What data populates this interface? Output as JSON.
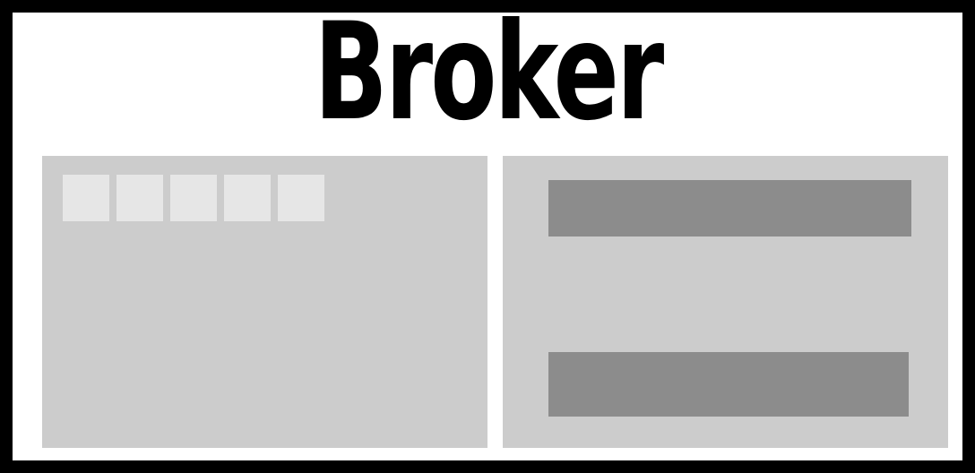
{
  "title": "Broker",
  "colors": {
    "border": "#000000",
    "background": "#ffffff",
    "panel": "#cccccc",
    "tile": "#e6e6e6",
    "bar": "#8c8c8c",
    "title_text": "#000000"
  },
  "left_panel": {
    "tile_count": 5
  },
  "right_panel": {
    "bar_count": 2
  }
}
